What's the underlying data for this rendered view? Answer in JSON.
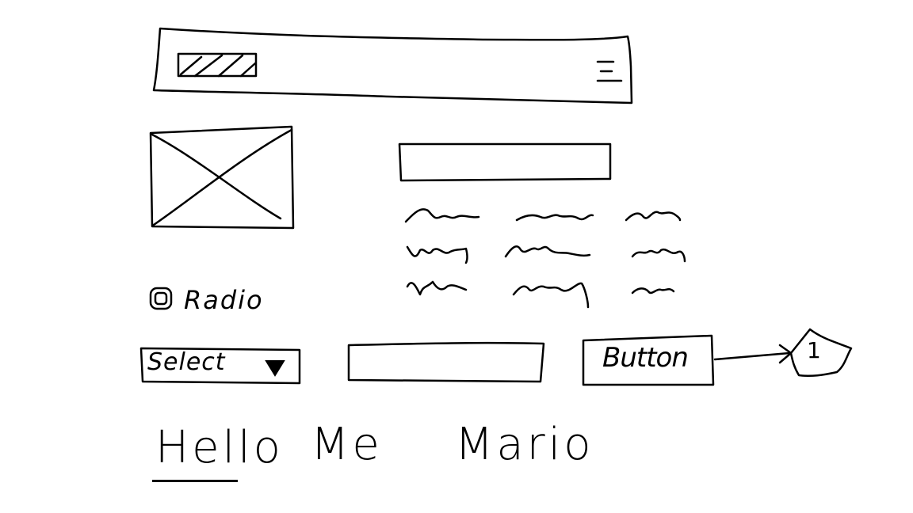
{
  "header": {
    "logo_name": "logo-placeholder",
    "menu_icon": "hamburger-menu-icon"
  },
  "image": {
    "icon": "image-placeholder-icon"
  },
  "top_input": {
    "value": "",
    "placeholder": ""
  },
  "text_block": {
    "description_lines": 3
  },
  "radio": {
    "label": "Radio",
    "checked": true
  },
  "select": {
    "value": "Select",
    "icon": "triangle-down-icon"
  },
  "mid_input": {
    "value": "",
    "placeholder": ""
  },
  "button": {
    "label": "Button"
  },
  "callout": {
    "number": "1"
  },
  "links": {
    "hello": "Hello",
    "me": "Me",
    "mario": "Mario"
  }
}
